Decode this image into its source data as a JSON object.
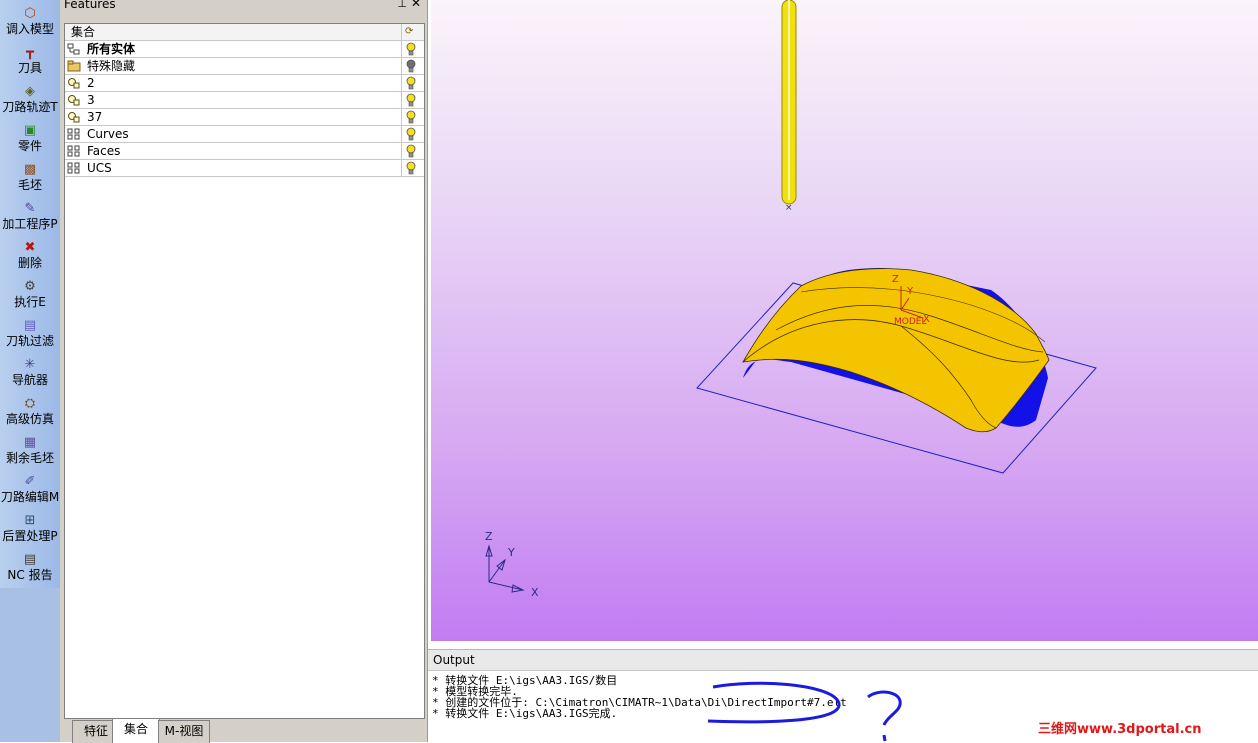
{
  "toolbar": {
    "items": [
      {
        "label": "调入模型",
        "icon": "import-model-icon"
      },
      {
        "label": "刀具",
        "icon": "tool-icon"
      },
      {
        "label": "刀路轨迹T",
        "icon": "toolpath-icon"
      },
      {
        "label": "零件",
        "icon": "part-icon"
      },
      {
        "label": "毛坯",
        "icon": "stock-icon"
      },
      {
        "label": "加工程序P",
        "icon": "procedure-icon"
      },
      {
        "label": "删除",
        "icon": "delete-icon"
      },
      {
        "label": "执行E",
        "icon": "execute-icon"
      },
      {
        "label": "刀轨过滤",
        "icon": "filter-icon"
      },
      {
        "label": "导航器",
        "icon": "navigator-icon"
      },
      {
        "label": "高级仿真",
        "icon": "simulation-icon"
      },
      {
        "label": "剩余毛坯",
        "icon": "remaining-stock-icon"
      },
      {
        "label": "刀路编辑M",
        "icon": "toolpath-edit-icon"
      },
      {
        "label": "后置处理P",
        "icon": "post-process-icon"
      },
      {
        "label": "NC 报告",
        "icon": "nc-report-icon"
      }
    ]
  },
  "features": {
    "title": "Features",
    "pin": "⊥",
    "close": "✕",
    "header": "集合",
    "rows": [
      {
        "name": "所有实体",
        "bold": true,
        "icon": "all-entities-icon",
        "bulb": "on"
      },
      {
        "name": "特殊隐藏",
        "bold": false,
        "icon": "folder-icon",
        "bulb": "off"
      },
      {
        "name": "2",
        "bold": false,
        "icon": "set-icon",
        "bulb": "on"
      },
      {
        "name": "3",
        "bold": false,
        "icon": "set-icon",
        "bulb": "on"
      },
      {
        "name": "37",
        "bold": false,
        "icon": "set-icon",
        "bulb": "on"
      },
      {
        "name": "Curves",
        "bold": false,
        "icon": "tree-icon",
        "bulb": "on"
      },
      {
        "name": "Faces",
        "bold": false,
        "icon": "tree-icon",
        "bulb": "on"
      },
      {
        "name": "UCS",
        "bold": false,
        "icon": "tree-icon",
        "bulb": "on"
      }
    ],
    "tabs": [
      "特征",
      "集合",
      "M-视图"
    ],
    "active_tab": "集合"
  },
  "viewport": {
    "model_label": "MODEL",
    "axis_z": "Z",
    "axis_y": "Y",
    "axis_x": "X",
    "colors": {
      "surface": "#f5c400",
      "underside": "#1111e8",
      "tool": "#f0e010",
      "background_top": "#fbf4fa",
      "background_bottom": "#c17cf2"
    }
  },
  "output": {
    "title": "Output",
    "lines": [
      "* 转换文件 E:\\igs\\AA3.IGS/数目",
      "* 模型转换完毕.",
      "* 创建的文件位于: C:\\Cimatron\\CIMATR~1\\Data\\Di\\DirectImport#7.elt",
      "* 转换文件 E:\\igs\\AA3.IGS完成."
    ]
  },
  "watermark": "三维网www.3dportal.cn"
}
